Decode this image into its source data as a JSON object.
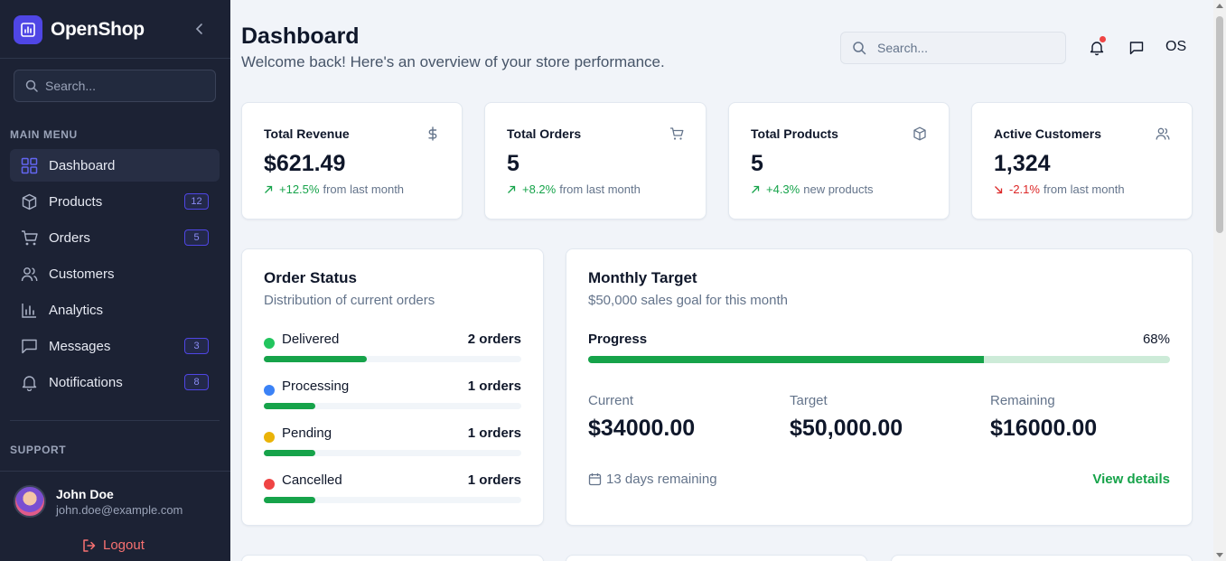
{
  "sidebar": {
    "brand": "OpenShop",
    "search_placeholder": "Search...",
    "main_menu_label": "MAIN MENU",
    "items": [
      {
        "label": "Dashboard",
        "icon": "grid-icon",
        "badge": ""
      },
      {
        "label": "Products",
        "icon": "box-icon",
        "badge": "12"
      },
      {
        "label": "Orders",
        "icon": "cart-icon",
        "badge": "5"
      },
      {
        "label": "Customers",
        "icon": "users-icon",
        "badge": ""
      },
      {
        "label": "Analytics",
        "icon": "bar-chart-icon",
        "badge": ""
      },
      {
        "label": "Messages",
        "icon": "message-icon",
        "badge": "3"
      },
      {
        "label": "Notifications",
        "icon": "bell-icon",
        "badge": "8"
      }
    ],
    "support_label": "SUPPORT",
    "user": {
      "name": "John Doe",
      "email": "john.doe@example.com"
    },
    "logout_label": "Logout"
  },
  "header": {
    "title": "Dashboard",
    "subtitle": "Welcome back! Here's an overview of your store performance.",
    "search_placeholder": "Search...",
    "user_initials": "OS"
  },
  "stats": [
    {
      "title": "Total Revenue",
      "value": "$621.49",
      "change": "+12.5%",
      "suffix": "from last month",
      "direction": "up",
      "icon": "dollar-icon"
    },
    {
      "title": "Total Orders",
      "value": "5",
      "change": "+8.2%",
      "suffix": "from last month",
      "direction": "up",
      "icon": "cart-icon"
    },
    {
      "title": "Total Products",
      "value": "5",
      "change": "+4.3%",
      "suffix": "new products",
      "direction": "up",
      "icon": "box-icon"
    },
    {
      "title": "Active Customers",
      "value": "1,324",
      "change": "-2.1%",
      "suffix": "from last month",
      "direction": "down",
      "icon": "users-icon"
    }
  ],
  "order_status": {
    "title": "Order Status",
    "subtitle": "Distribution of current orders",
    "rows": [
      {
        "name": "Delivered",
        "count": "2 orders",
        "fraction": 0.4,
        "color": "#22c55e"
      },
      {
        "name": "Processing",
        "count": "1 orders",
        "fraction": 0.2,
        "color": "#3b82f6"
      },
      {
        "name": "Pending",
        "count": "1 orders",
        "fraction": 0.2,
        "color": "#eab308"
      },
      {
        "name": "Cancelled",
        "count": "1 orders",
        "fraction": 0.2,
        "color": "#ef4444"
      }
    ]
  },
  "monthly_target": {
    "title": "Monthly Target",
    "subtitle": "$50,000 sales goal for this month",
    "progress_label": "Progress",
    "progress_percent": "68%",
    "progress_fraction": 0.68,
    "metrics": [
      {
        "label": "Current",
        "value": "$34000.00"
      },
      {
        "label": "Target",
        "value": "$50,000.00"
      },
      {
        "label": "Remaining",
        "value": "$16000.00"
      }
    ],
    "days_remaining": "13 days remaining",
    "view_details": "View details"
  },
  "colors": {
    "accent": "#4f46e5",
    "success": "#16a34a",
    "danger": "#dc2626",
    "sidebar_bg": "#1c2234"
  }
}
